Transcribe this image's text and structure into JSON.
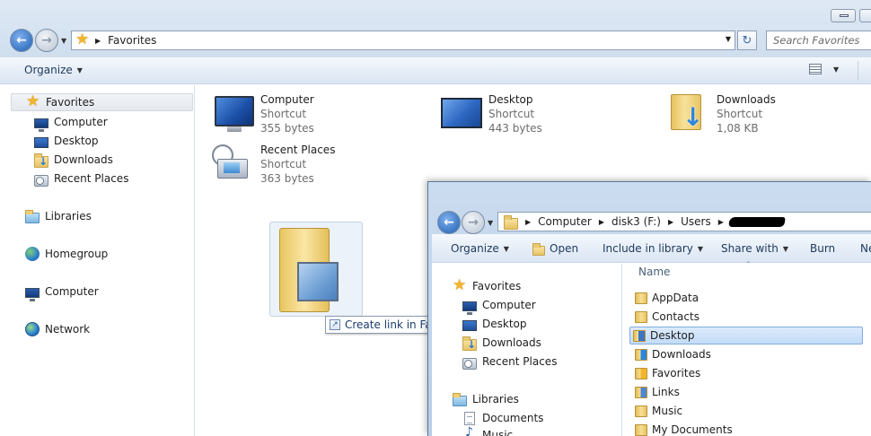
{
  "window_main": {
    "address": {
      "crumbs": [
        "Favorites"
      ]
    },
    "search": {
      "placeholder": "Search Favorites"
    },
    "toolbar": {
      "organize": "Organize"
    },
    "nav": {
      "favorites": "Favorites",
      "favorites_items": [
        "Computer",
        "Desktop",
        "Downloads",
        "Recent Places"
      ],
      "libraries": "Libraries",
      "homegroup": "Homegroup",
      "computer": "Computer",
      "network": "Network"
    },
    "content_items": [
      {
        "name": "Computer",
        "type": "Shortcut",
        "size": "355 bytes",
        "icon": "computer-shortcut-icon"
      },
      {
        "name": "Desktop",
        "type": "Shortcut",
        "size": "443 bytes",
        "icon": "desktop-shortcut-icon"
      },
      {
        "name": "Downloads",
        "type": "Shortcut",
        "size": "1,08 KB",
        "icon": "downloads-folder-icon"
      },
      {
        "name": "Recent Places",
        "type": "Shortcut",
        "size": "363 bytes",
        "icon": "recent-places-icon"
      }
    ]
  },
  "drag": {
    "tooltip": "Create link in Favorites"
  },
  "window_second": {
    "address": {
      "crumbs": [
        "Computer",
        "disk3 (F:)",
        "Users"
      ]
    },
    "toolbar": {
      "organize": "Organize",
      "open": "Open",
      "include_in_library": "Include in library",
      "share_with": "Share with",
      "burn": "Burn",
      "new_folder_partial": "Ne"
    },
    "nav": {
      "favorites": "Favorites",
      "favorites_items": [
        "Computer",
        "Desktop",
        "Downloads",
        "Recent Places"
      ],
      "libraries": "Libraries",
      "library_items": [
        "Documents",
        "Music"
      ]
    },
    "list": {
      "column_name": "Name",
      "rows": [
        "AppData",
        "Contacts",
        "Desktop",
        "Downloads",
        "Favorites",
        "Links",
        "Music",
        "My Documents"
      ],
      "selected": "Desktop"
    }
  },
  "colors": {
    "accent": "#1f5fb4",
    "selection": "#c3dcf8",
    "toolbar_text": "#1e395b"
  }
}
